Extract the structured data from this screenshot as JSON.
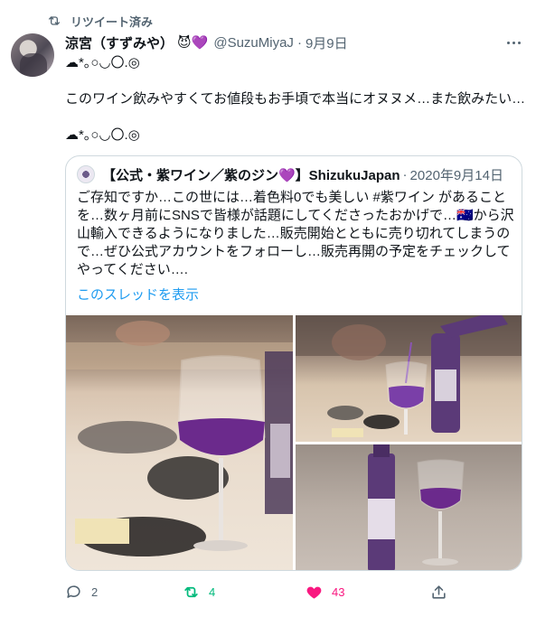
{
  "retweet": {
    "label": "リツイート済み"
  },
  "tweet": {
    "author_name": "涼宮（すずみや）",
    "author_emoji": "😈💜",
    "handle": "@SuzuMiyaJ",
    "date": "9月9日",
    "text": "☁*｡○◡〇.◎\n\nこのワイン飲みやすくてお値段もお手頃で本当にオヌヌメ…また飲みたい…\n\n☁*｡○◡〇.◎"
  },
  "quote": {
    "author_name": "【公式・紫ワイン／紫のジン💜】ShizukuJapan",
    "date": "2020年9月14日",
    "text": "ご存知ですか…この世には…着色料0でも美しい #紫ワイン があることを…数ヶ月前にSNSで皆様が話題にしてくださったおかげで…🇦🇺から沢山輸入できるようになりました…販売開始とともに売り切れてしまうので…ぜひ公式アカウントをフォローし…販売再開の予定をチェックしてやってください….",
    "thread_link": "このスレッドを表示"
  },
  "actions": {
    "reply_count": "2",
    "retweet_count": "4",
    "like_count": "43"
  },
  "colors": {
    "accent": "#1d9bf0",
    "retweet": "#00ba7c",
    "like": "#f91880",
    "muted": "#536471",
    "wine": "#6b2a8c"
  }
}
